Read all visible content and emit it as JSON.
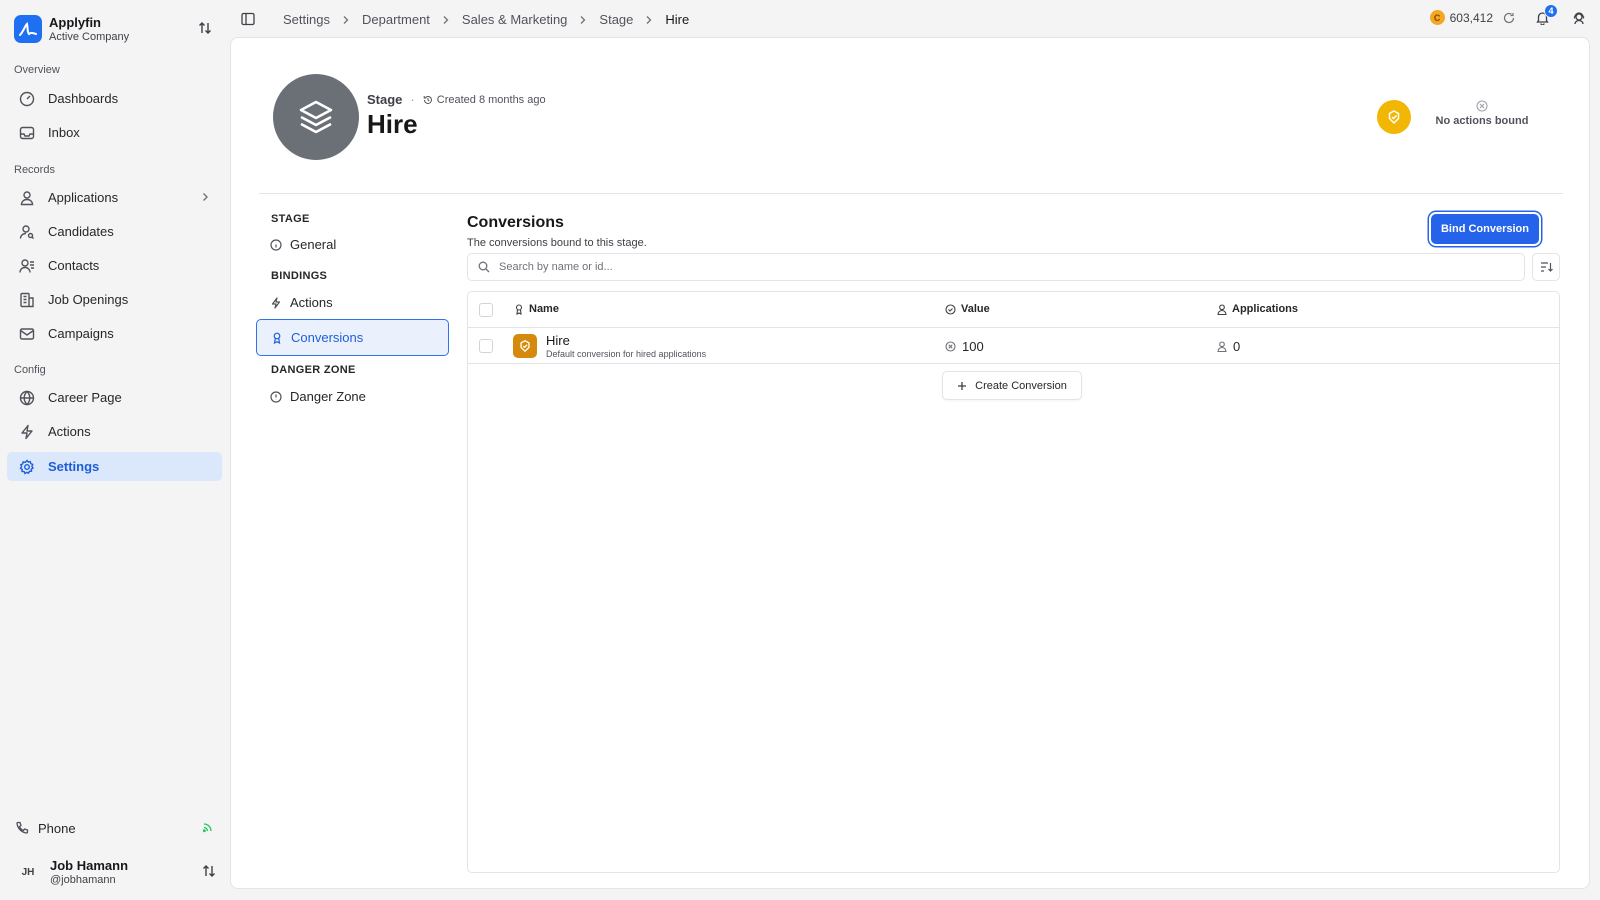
{
  "brand": {
    "name": "Applyfin",
    "subtitle": "Active Company"
  },
  "sidebar": {
    "sections": {
      "overview": "Overview",
      "records": "Records",
      "config": "Config"
    },
    "items": [
      {
        "label": "Dashboards",
        "icon": "dashboard-gauge-icon"
      },
      {
        "label": "Inbox",
        "icon": "inbox-icon"
      },
      {
        "label": "Applications",
        "icon": "user-icon"
      },
      {
        "label": "Candidates",
        "icon": "user-search-icon"
      },
      {
        "label": "Contacts",
        "icon": "contacts-icon"
      },
      {
        "label": "Job Openings",
        "icon": "building-icon"
      },
      {
        "label": "Campaigns",
        "icon": "mail-icon"
      },
      {
        "label": "Career Page",
        "icon": "globe-icon"
      },
      {
        "label": "Actions",
        "icon": "bolt-icon"
      },
      {
        "label": "Settings",
        "icon": "gear-icon",
        "active": true
      }
    ],
    "phone": "Phone",
    "user": {
      "initials": "JH",
      "name": "Job Hamann",
      "handle": "@jobhamann"
    }
  },
  "topbar": {
    "breadcrumbs": [
      "Settings",
      "Department",
      "Sales & Marketing",
      "Stage",
      "Hire"
    ],
    "coin_symbol": "C",
    "balance": "603,412",
    "notifications": "4"
  },
  "header": {
    "kind": "Stage",
    "created": "Created 8 months ago",
    "title": "Hire",
    "no_actions": "No actions bound"
  },
  "subnav": {
    "stage_label": "STAGE",
    "general": "General",
    "bindings_label": "BINDINGS",
    "actions": "Actions",
    "conversions": "Conversions",
    "danger_label": "DANGER ZONE",
    "danger": "Danger Zone"
  },
  "content": {
    "title": "Conversions",
    "description": "The conversions bound to this stage.",
    "bind_button": "Bind Conversion",
    "search_placeholder": "Search by name or id...",
    "columns": {
      "name": "Name",
      "value": "Value",
      "applications": "Applications"
    },
    "rows": [
      {
        "name": "Hire",
        "description": "Default conversion for hired applications",
        "value": "100",
        "applications": "0"
      }
    ],
    "create_button": "Create Conversion"
  },
  "colors": {
    "accent": "#2563eb",
    "hero_badge": "#f2b705",
    "row_icon": "#d68a0c",
    "avatar": "#6b6f76"
  }
}
